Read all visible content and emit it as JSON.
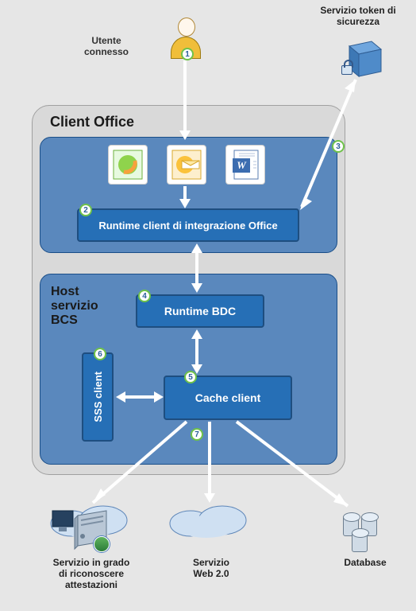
{
  "labels": {
    "user": "Utente\nconnesso",
    "sts": "Servizio token di\nsicurezza",
    "client_office": "Client Office",
    "office_runtime": "Runtime client di integrazione Office",
    "host_bcs": "Host\nservizio\nBCS",
    "bdc": "Runtime BDC",
    "sss": "SSS client",
    "cache": "Cache client",
    "claims_svc": "Servizio in grado\ndi riconoscere\nattestazioni",
    "web20": "Servizio\nWeb 2.0",
    "db": "Database"
  },
  "badges": {
    "b1": "1",
    "b2": "2",
    "b3": "3",
    "b4": "4",
    "b5": "5",
    "b6": "6",
    "b7": "7"
  },
  "icons": {
    "spd": "SPD",
    "outlook": "Outlook",
    "word": "Word"
  }
}
